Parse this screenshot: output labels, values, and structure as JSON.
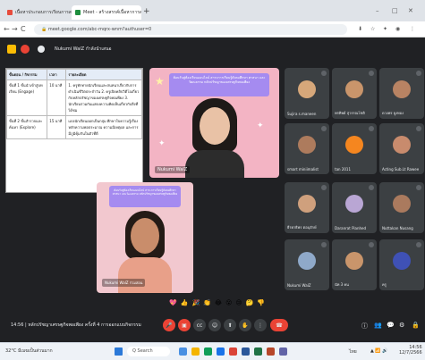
{
  "browser": {
    "tabs": [
      {
        "label": "เนื้อหาประกอบการเรียนการสอน",
        "fav_color": "#e74c3c"
      },
      {
        "label": "Meet - สร้างสรรค์เนื้อหาการสอน",
        "fav_color": "#1e8e3e"
      }
    ],
    "new_tab": "+",
    "url": "meet.google.com/abc-mqrx-wnm?authuser=0",
    "win_min": "–",
    "win_max": "□",
    "win_close": "✕",
    "nav_back": "←",
    "nav_forward": "→",
    "nav_reload": "C",
    "nav_home": "⌂"
  },
  "meet": {
    "presenter_label": "Nukumi WalZ กำลังนำเสนอ",
    "time": "14:56",
    "meeting_title": "หลักปรัชญาเศรษฐกิจพอเพียง ครั้งที่ 4 การออกแบบกิจกรรม",
    "reactions": [
      "💖",
      "👍",
      "🎉",
      "👏",
      "😂",
      "😮",
      "😢",
      "🤔",
      "👎"
    ],
    "controls": [
      "mic",
      "cam",
      "cc",
      "emoji",
      "present",
      "raise",
      "more",
      "end"
    ],
    "right_controls": [
      "ⓘ",
      "👥",
      "💬",
      "⚙",
      "🔒"
    ]
  },
  "slide": {
    "col1_header": "ขั้นตอน / กิจกรรม",
    "col2_header": "เวลา",
    "col3_header": "รายละเอียด",
    "rows": [
      {
        "step": "ขั้นที่ 1 ขั้นนำเข้าสู่บทเรียน (Engage)",
        "time": "10 นาที",
        "detail": "1. ครูทักทายนักเรียนและสนทนาเกี่ยวกับการดำเนินชีวิตประจำวัน 2. ครูเปิดคลิปวิดีโอเกี่ยวกับหลักปรัชญาของเศรษฐกิจพอเพียง 3. นักเรียนร่วมกันแสดงความคิดเห็นเกี่ยวกับสิ่งที่ได้ชม"
      },
      {
        "step": "ขั้นที่ 2 ขั้นสำรวจและค้นหา (Explore)",
        "time": "15 นาที",
        "detail": "แบ่งนักเรียนออกเป็นกลุ่ม ศึกษาใบความรู้เรื่องหลักความพอประมาณ ความมีเหตุผล และการมีภูมิคุ้มกันในตัวที่ดี"
      }
    ]
  },
  "tiles": {
    "main_presenter": "Nukumi WalZ",
    "banner_text": "ต้อนรับสู่ห้องเรียนออนไลน์ สาระการเรียนรู้สังคมศึกษา ศาสนา และวัฒนธรรม หลักปรัชญาของเศรษฐกิจพอเพียง",
    "second_presenter": "Nukumi WalZ ร่วมสอน",
    "participants": [
      {
        "name": "Sujira s.maneen",
        "color": "#d6a77a"
      },
      {
        "name": "พรทิพย์ สุวรรณโชติ",
        "color": "#c9956b"
      },
      {
        "name": "ดวงพร ยูงทอง",
        "color": "#b88363"
      },
      {
        "name": "smart miniimalist",
        "color": "#ad7b5d"
      },
      {
        "name": "tan 2011",
        "color": "#f5861f"
      },
      {
        "name": "Acting Sub.Lt Rawee",
        "color": "#c88b6d"
      },
      {
        "name": "ธีรยาธิพร ตอนุรักษ์",
        "color": "#cfa07d"
      },
      {
        "name": "Daranrat Pianhed",
        "color": "#b9a6d4"
      },
      {
        "name": "Nuttakan Nusang",
        "color": "#aa7a5e"
      },
      {
        "name": "Nukumi WalZ",
        "color": "#8fa9c9"
      },
      {
        "name": "นัท 3 คน",
        "color": "#c9956b"
      },
      {
        "name": "ครู",
        "color": "#3f51b5"
      }
    ]
  },
  "taskbar": {
    "weather": "32°C มีเมฆเป็นส่วนมาก",
    "search": "Q Search",
    "sys_time": "14:56",
    "sys_date": "12/7/2566",
    "lang": "ไทย"
  }
}
